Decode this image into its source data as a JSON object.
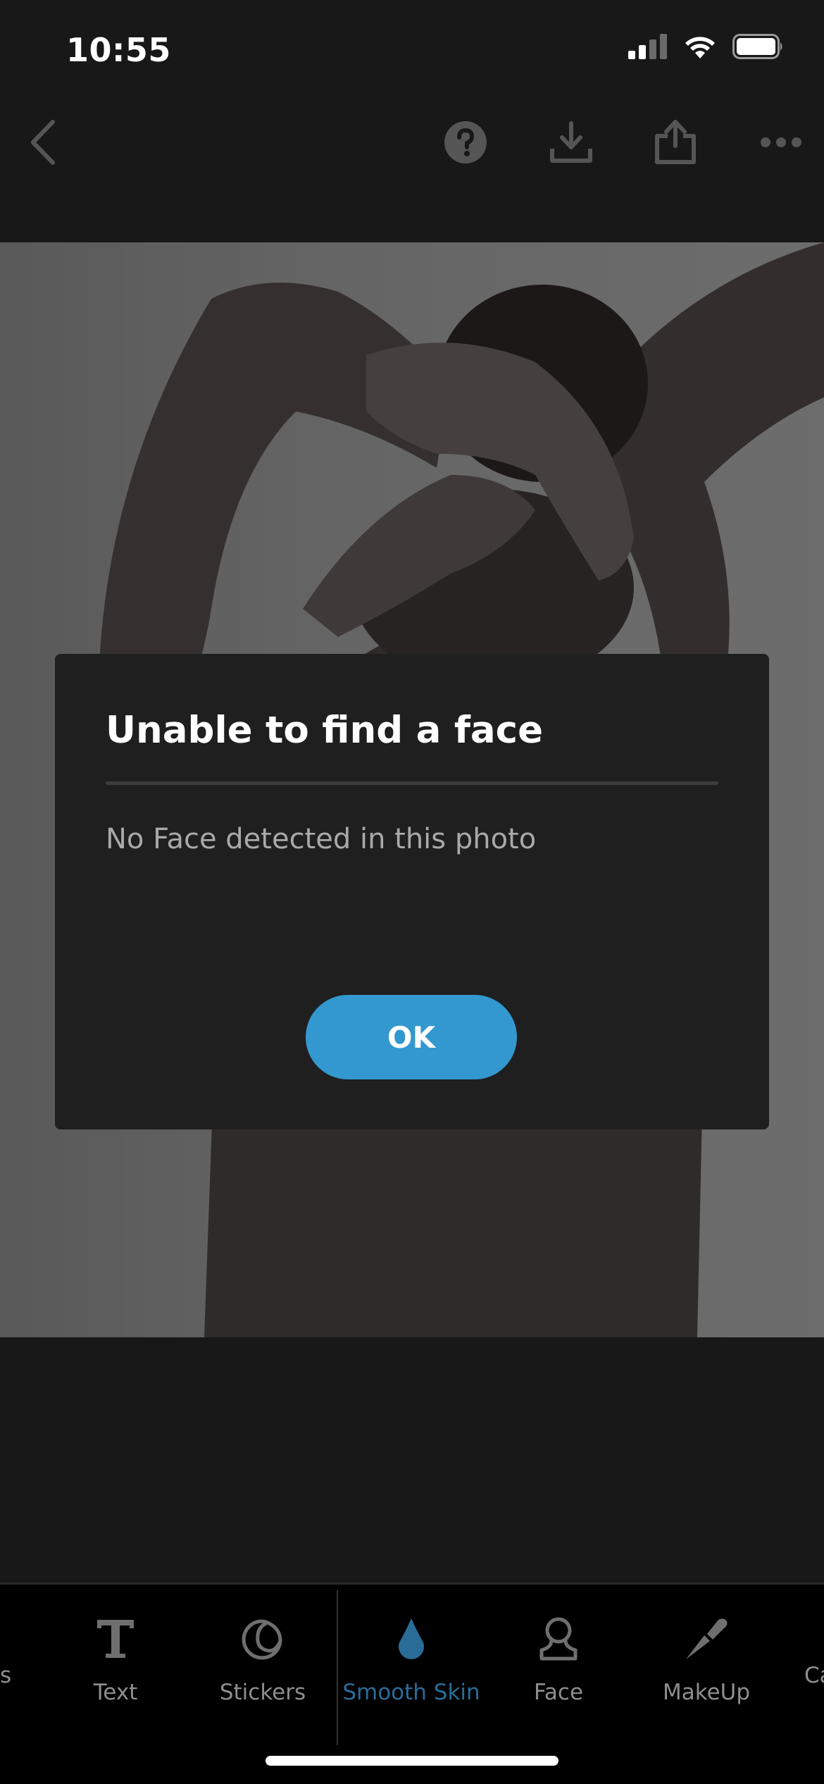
{
  "status_bar": {
    "time": "10:55"
  },
  "dialog": {
    "title": "Unable to find a face",
    "message": "No Face detected in this photo",
    "ok_label": "OK"
  },
  "toolbar": {
    "partial_left": "s",
    "items": [
      {
        "label": "Text",
        "icon": "text-icon",
        "active": false
      },
      {
        "label": "Stickers",
        "icon": "sticker-icon",
        "active": false
      },
      {
        "label": "Smooth Skin",
        "icon": "drop-icon",
        "active": true
      },
      {
        "label": "Face",
        "icon": "face-icon",
        "active": false
      },
      {
        "label": "MakeUp",
        "icon": "brush-icon",
        "active": false
      }
    ],
    "partial_right": "Ca"
  },
  "colors": {
    "background": "#181818",
    "dialog_bg": "#1f1f1f",
    "accent": "#3398cf",
    "active_tool": "#2a6c98",
    "inactive_tool": "#8e8e8e"
  }
}
